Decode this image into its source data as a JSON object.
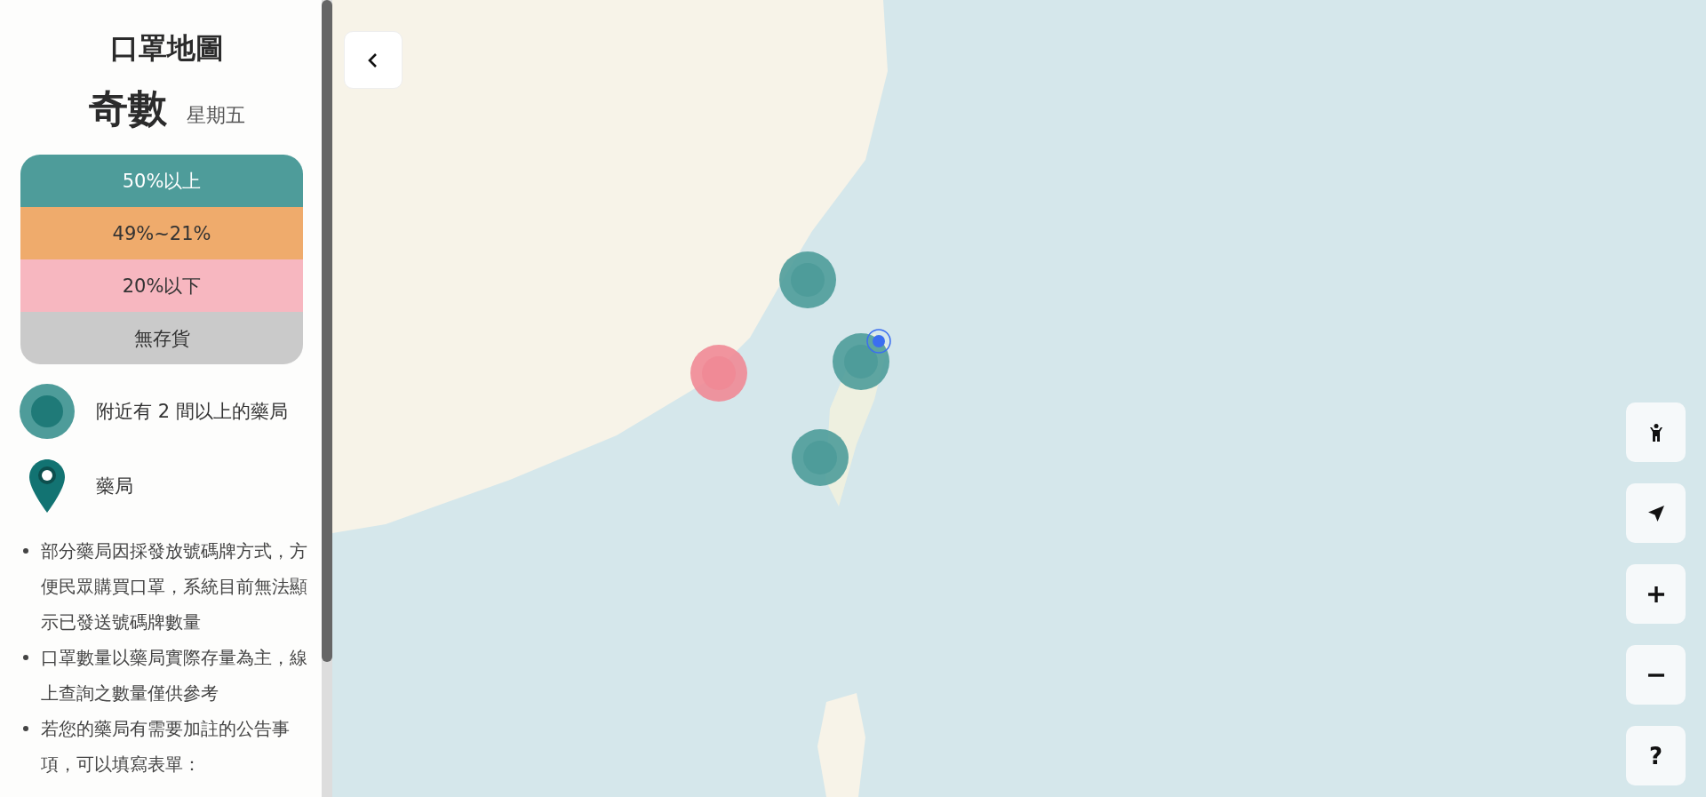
{
  "sidebar": {
    "title": "口罩地圖",
    "day_type": "奇數",
    "weekday": "星期五",
    "legend": [
      {
        "label": "50%以上",
        "color": "#4e9c9a"
      },
      {
        "label": "49%~21%",
        "color": "#efab6c"
      },
      {
        "label": "20%以下",
        "color": "#f7b7c0"
      },
      {
        "label": "無存貨",
        "color": "#cacaca"
      }
    ],
    "cluster_legend": {
      "label": "附近有 2 間以上的藥局"
    },
    "pin_legend": {
      "label": "藥局"
    },
    "notes": [
      "部分藥局因採發放號碼牌方式，方便民眾購買口罩，系統目前無法顯示已發送號碼牌數量",
      "口罩數量以藥局實際存量為主，線上查詢之數量僅供參考",
      "若您的藥局有需要加註的公告事項，可以填寫表單："
    ]
  },
  "map": {
    "markers": [
      {
        "kind": "cluster",
        "color": "#4e9c9a"
      },
      {
        "kind": "cluster",
        "color": "#4e9c9a"
      },
      {
        "kind": "cluster",
        "color": "#4e9c9a"
      },
      {
        "kind": "cluster",
        "color": "#f08a96"
      },
      {
        "kind": "location",
        "color": "#3b6ef0"
      }
    ],
    "controls": [
      {
        "kind": "person"
      },
      {
        "kind": "locate"
      },
      {
        "kind": "zoom-in"
      },
      {
        "kind": "zoom-out"
      },
      {
        "kind": "help",
        "label": "?"
      }
    ]
  }
}
